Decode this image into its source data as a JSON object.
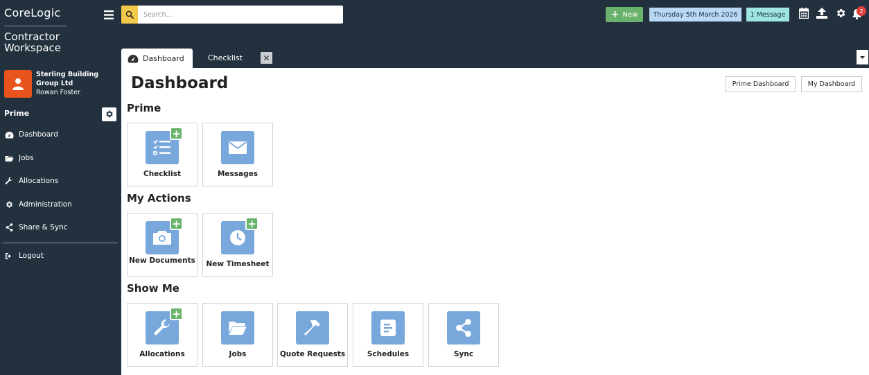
{
  "brand": {
    "name": "CoreLogic",
    "product_line1": "Contractor",
    "product_line2": "Workspace"
  },
  "user": {
    "company": "Sterling Building Group Ltd",
    "name": "Rowan Foster"
  },
  "sidebar": {
    "section_title": "Prime",
    "items": [
      {
        "label": "Dashboard",
        "icon": "dashboard-icon"
      },
      {
        "label": "Jobs",
        "icon": "folder-icon"
      },
      {
        "label": "Allocations",
        "icon": "wrench-icon"
      },
      {
        "label": "Administration",
        "icon": "gear-icon"
      },
      {
        "label": "Share & Sync",
        "icon": "share-icon"
      }
    ],
    "logout_label": "Logout"
  },
  "topbar": {
    "search_placeholder": "Search...",
    "new_label": "New",
    "date": "Thursday 5th March 2026",
    "messages": "1 Message",
    "notification_count": "2"
  },
  "tabs": {
    "active": "Dashboard",
    "inactive": "Checklist",
    "close_symbol": "✕"
  },
  "main": {
    "title": "Dashboard",
    "buttons": {
      "prime_dashboard": "Prime Dashboard",
      "my_dashboard": "My Dashboard"
    },
    "groups": [
      {
        "title": "Prime",
        "tiles": [
          {
            "label": "Checklist",
            "icon": "checklist-icon",
            "plus": true
          },
          {
            "label": "Messages",
            "icon": "envelope-icon",
            "plus": false
          }
        ]
      },
      {
        "title": "My Actions",
        "tiles": [
          {
            "label": "New Documents",
            "icon": "camera-icon",
            "plus": true
          },
          {
            "label": "New Timesheet",
            "icon": "clock-icon",
            "plus": true
          }
        ]
      },
      {
        "title": "Show Me",
        "tiles": [
          {
            "label": "Allocations",
            "icon": "wrench-icon",
            "plus": true
          },
          {
            "label": "Jobs",
            "icon": "folder-open-icon",
            "plus": false
          },
          {
            "label": "Quote Requests",
            "icon": "hammer-icon",
            "plus": false
          },
          {
            "label": "Schedules",
            "icon": "schedule-icon",
            "plus": false
          },
          {
            "label": "Sync",
            "icon": "share-icon",
            "plus": false
          }
        ]
      }
    ]
  },
  "colors": {
    "sidebar_bg": "#23313f",
    "accent_orange": "#e8541c",
    "tile_blue": "#78a8db",
    "plus_green": "#6ab36c",
    "search_yellow": "#f3c94a"
  }
}
